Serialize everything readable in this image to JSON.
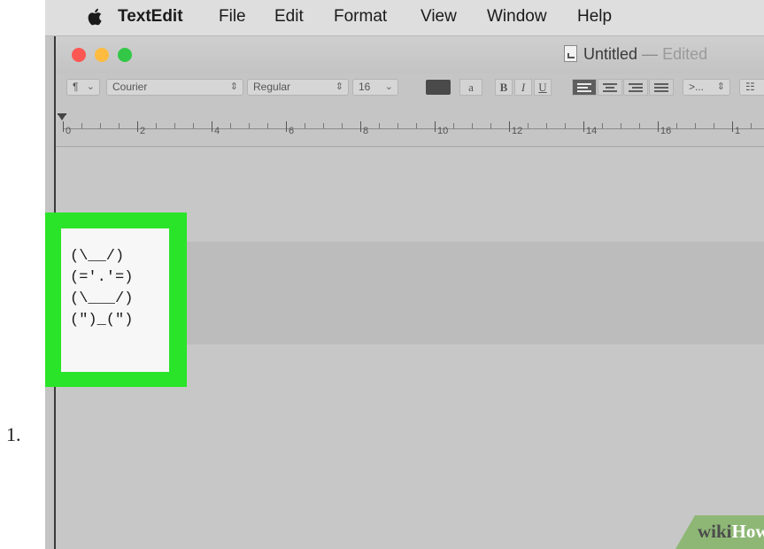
{
  "step_number": "1.",
  "menubar": {
    "app_name": "TextEdit",
    "items": [
      "File",
      "Edit",
      "Format",
      "View",
      "Window",
      "Help"
    ]
  },
  "window": {
    "title": "Untitled",
    "title_separator": "—",
    "status": "Edited",
    "traffic_light_colors": {
      "close": "#fc5753",
      "minimize": "#fdbc40",
      "zoom": "#33c748"
    }
  },
  "format_bar": {
    "paragraph_style": "¶",
    "font_family": "Courier",
    "font_style": "Regular",
    "font_size": "16",
    "text_color": "#4a4a4a",
    "styles_btn": "a",
    "bold": "B",
    "italic": "I",
    "underline": "U",
    "alignment_selected": "left",
    "spacing": ">..."
  },
  "ruler": {
    "labels": [
      "0",
      "2",
      "4",
      "6",
      "8",
      "10",
      "12",
      "14",
      "16",
      "1"
    ]
  },
  "document": {
    "ascii_art": [
      "(\\__/)",
      "(='.'=)",
      "(\\___/)",
      "(\")_(\")"
    ]
  },
  "callout_color": "#2ae42a",
  "watermark": {
    "part1": "wiki",
    "part2": "How"
  }
}
